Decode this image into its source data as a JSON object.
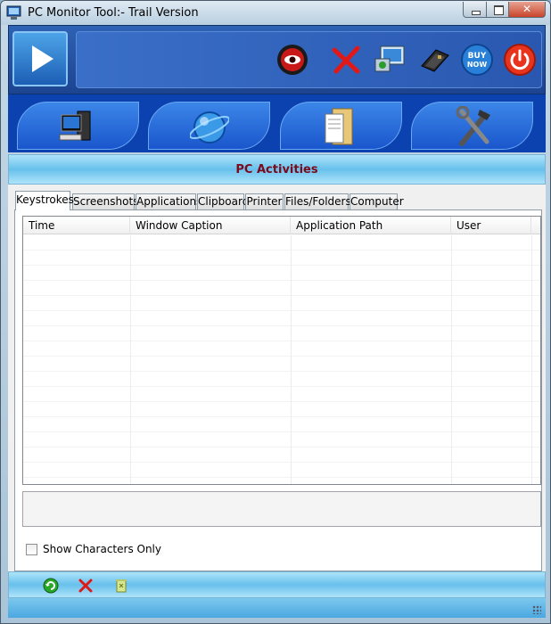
{
  "window": {
    "title": "PC Monitor Tool:- Trail Version"
  },
  "toolbar": {
    "icons": [
      "record-icon",
      "delete-icon",
      "network-monitor-icon",
      "book-icon",
      "buy-now-icon",
      "power-icon"
    ],
    "buy_now_label": "BUY NOW"
  },
  "nav": {
    "tabs": [
      {
        "name": "computer-tab",
        "icon": "computer-icon"
      },
      {
        "name": "internet-tab",
        "icon": "globe-icon"
      },
      {
        "name": "files-tab",
        "icon": "documents-icon"
      },
      {
        "name": "settings-tab",
        "icon": "tools-icon"
      }
    ]
  },
  "section": {
    "title": "PC Activities"
  },
  "tabs": [
    "Keystrokes",
    "Screenshots",
    "Applications",
    "Clipboard",
    "Printer",
    "Files/Folders",
    "Computer"
  ],
  "grid": {
    "columns": [
      "Time",
      "Window Caption",
      "Application Path",
      "User"
    ],
    "rows": []
  },
  "options": {
    "show_characters_only": "Show Characters Only",
    "checked": false
  },
  "footer": {
    "icons": [
      "refresh-icon",
      "delete-icon",
      "trash-icon"
    ]
  },
  "colors": {
    "title_accent": "#7a0a1a",
    "header_blue": "#1c4490",
    "nav_blue": "#0c42b0"
  }
}
